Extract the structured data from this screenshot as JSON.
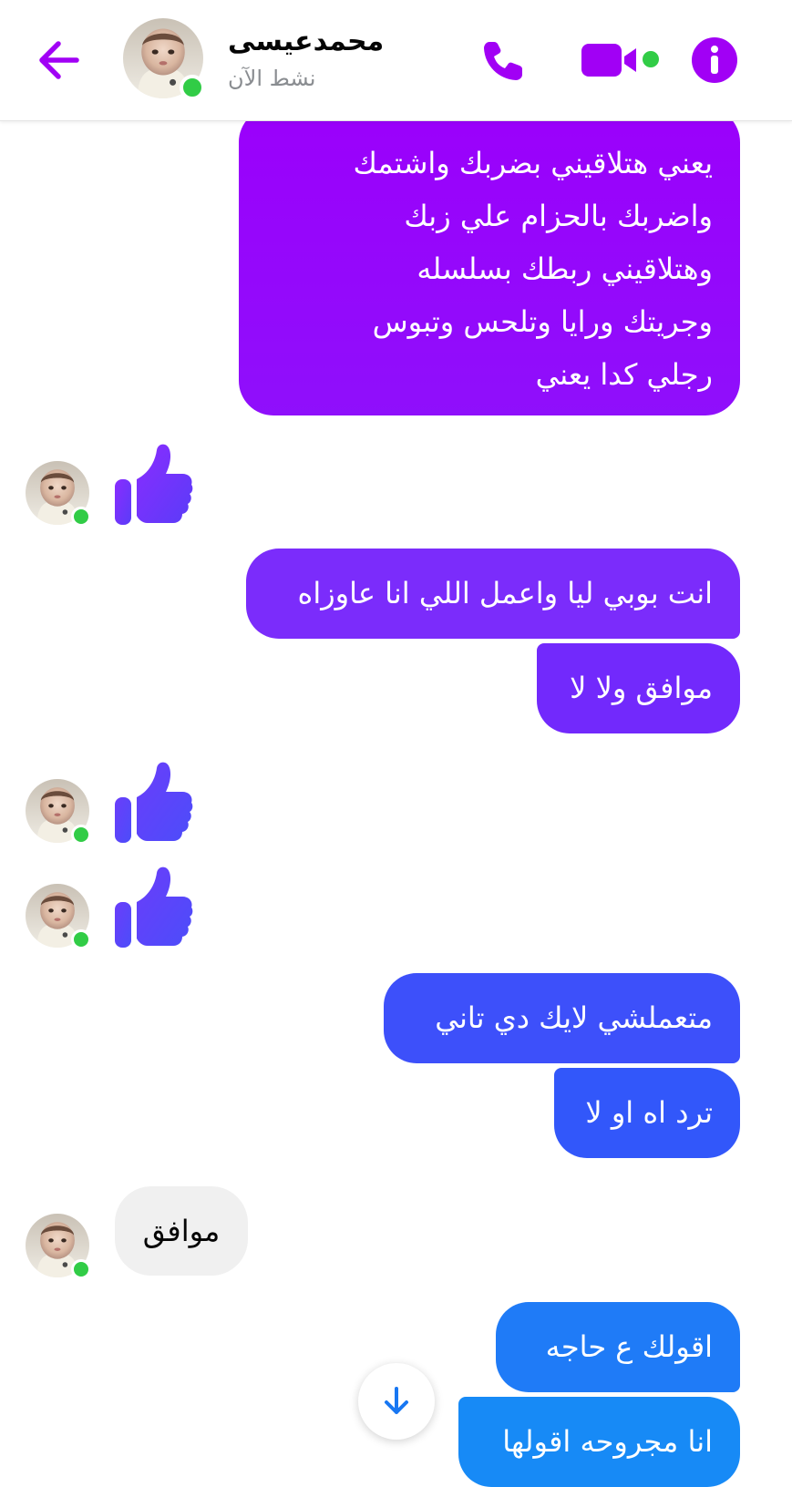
{
  "header": {
    "contact_name": "محمدعيسى",
    "status": "نشط الآن",
    "icons": [
      "back-arrow-icon",
      "phone-icon",
      "video-camera-icon",
      "info-icon"
    ],
    "accent_color": "#a100f5",
    "online_color": "#31cc46"
  },
  "messages": [
    {
      "from": "me",
      "lines": [
        "يعني هتلاقيني بضربك واشتمك",
        "واضربك بالحزام علي زبك",
        "وهتلاقيني ربطك بسلسله",
        "وجريتك ورايا وتلحس وتبوس",
        "رجلي كدا يعني"
      ]
    },
    {
      "from": "contact",
      "type": "like"
    },
    {
      "from": "me",
      "text": "انت بوبي ليا واعمل اللي انا عاوزاه"
    },
    {
      "from": "me",
      "text": "موافق ولا لا"
    },
    {
      "from": "contact",
      "type": "like"
    },
    {
      "from": "contact",
      "type": "like"
    },
    {
      "from": "me",
      "text": "متعملشي لايك دي تاني"
    },
    {
      "from": "me",
      "text": "ترد اه او لا"
    },
    {
      "from": "contact",
      "text": "موافق"
    },
    {
      "from": "me",
      "text": "اقولك ع حاجه"
    },
    {
      "from": "me",
      "text": "انا مجروحه اقولها"
    }
  ],
  "scroll_button": {
    "icon": "arrow-down-icon"
  }
}
